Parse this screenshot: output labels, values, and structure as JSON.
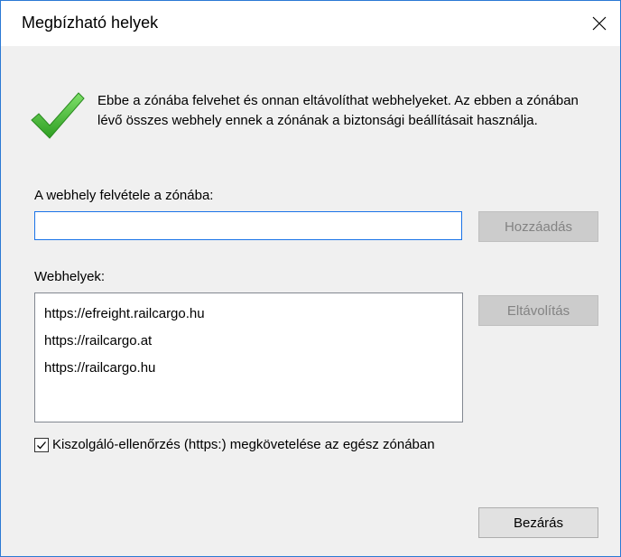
{
  "dialog": {
    "title": "Megbízható helyek",
    "close_icon": "close-icon",
    "info_icon": "green-checkmark-icon",
    "info_text": "Ebbe a zónába felvehet és onnan eltávolíthat webhelyeket. Az ebben a zónában lévő összes webhely ennek a zónának a biztonsági beállításait használja.",
    "add_label": "A webhely felvétele a zónába:",
    "add_input_value": "",
    "add_button": "Hozzáadás",
    "sites_label": "Webhelyek:",
    "sites": [
      "https://efreight.railcargo.hu",
      "https://railcargo.at",
      "https://railcargo.hu"
    ],
    "remove_button": "Eltávolítás",
    "require_https_label": "Kiszolgáló-ellenőrzés (https:) megkövetelése az egész zónában",
    "require_https_checked": true,
    "close_button": "Bezárás"
  },
  "colors": {
    "window_border": "#2b79d4",
    "dialog_bg": "#f0f0f0",
    "input_focus_border": "#1a73e8",
    "check_green": "#3dbb2f"
  }
}
